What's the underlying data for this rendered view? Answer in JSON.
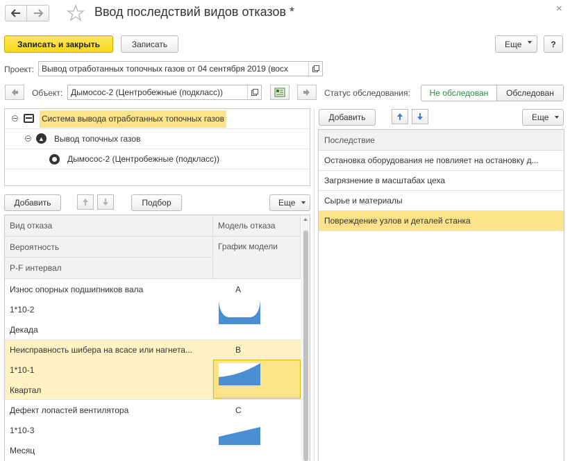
{
  "window": {
    "title": "Ввод последствий видов отказов *",
    "close_glyph": "×"
  },
  "toolbar": {
    "save_close_label": "Записать и закрыть",
    "save_label": "Записать",
    "more_label": "Еще",
    "help_label": "?"
  },
  "project": {
    "label": "Проект:",
    "value": "Вывод отработанных топочных газов от 04 сентября 2019 (восх"
  },
  "object": {
    "label": "Объект:",
    "value": "Дымосос-2 (Центробежные (подкласс))"
  },
  "status": {
    "label": "Статус обследования:",
    "options": [
      "Не обследован",
      "Обследован"
    ],
    "selected": "Не обследован"
  },
  "tree": {
    "items": [
      {
        "label": "Система вывода отработанных топочных газов",
        "level": 0,
        "highlighted": true
      },
      {
        "label": "Вывод топочных газов",
        "level": 1,
        "highlighted": false
      },
      {
        "label": "Дымосос-2 (Центробежные (подкласс))",
        "level": 2,
        "highlighted": false
      }
    ]
  },
  "failures_toolbar": {
    "add_label": "Добавить",
    "select_label": "Подбор",
    "more_label": "Еще"
  },
  "failures_grid": {
    "headers": {
      "type": "Вид отказа",
      "model": "Модель отказа",
      "probability": "Вероятность",
      "chart": "График модели",
      "pf": "P-F интервал"
    },
    "rows": [
      {
        "type": "Износ опорных подшипников вала",
        "model": "A",
        "probability": "1*10-2",
        "pf": "Декада",
        "chart_shape": "bathtub",
        "selected": false
      },
      {
        "type": "Неисправность шибера на всасе или нагнета...",
        "model": "B",
        "probability": "1*10-1",
        "pf": "Квартал",
        "chart_shape": "increasing-curve",
        "selected": true
      },
      {
        "type": "Дефект лопастей вентилятора",
        "model": "C",
        "probability": "1*10-3",
        "pf": "Месяц",
        "chart_shape": "linear-increase",
        "selected": false
      }
    ]
  },
  "consequences_toolbar": {
    "add_label": "Добавить",
    "more_label": "Еще"
  },
  "consequences": {
    "header": "Последствие",
    "items": [
      {
        "label": "Остановка оборудования не повлияет на остановку д...",
        "selected": false
      },
      {
        "label": "Загрязнение в масштабах цеха",
        "selected": false
      },
      {
        "label": "Сырье и материалы",
        "selected": false
      },
      {
        "label": "Повреждение узлов и деталей станка",
        "selected": true
      }
    ]
  },
  "colors": {
    "primary_button": "#f7d51a",
    "status_selected_text": "#2a8a3e",
    "row_highlight": "#fdf2c4",
    "row_selected": "#fbe38a",
    "chart_fill": "#4b8ed4",
    "tree_highlight": "#fbe38a"
  },
  "icons": {
    "back": "arrow-left-icon",
    "forward": "arrow-right-icon",
    "favorite": "star-icon",
    "open": "open-window-icon",
    "map": "map-icon",
    "collapse": "collapse-circle-icon",
    "up": "arrow-up-icon",
    "down": "arrow-down-icon"
  }
}
